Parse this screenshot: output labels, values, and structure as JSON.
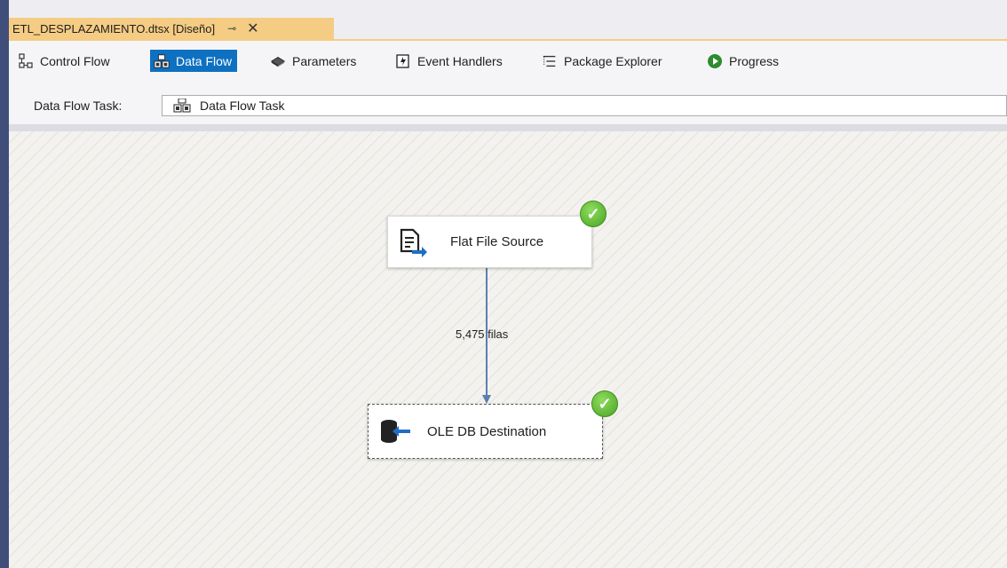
{
  "document_tab": {
    "title": "ETL_DESPLAZAMIENTO.dtsx [Diseño]",
    "pin_icon": "pin-icon",
    "close_icon": "close-icon"
  },
  "designer_tabs": [
    {
      "label": "Control Flow",
      "icon": "control-flow-icon",
      "active": false
    },
    {
      "label": "Data Flow",
      "icon": "data-flow-icon",
      "active": true
    },
    {
      "label": "Parameters",
      "icon": "parameters-icon",
      "active": false
    },
    {
      "label": "Event Handlers",
      "icon": "event-handlers-icon",
      "active": false
    },
    {
      "label": "Package Explorer",
      "icon": "package-explorer-icon",
      "active": false
    },
    {
      "label": "Progress",
      "icon": "progress-icon",
      "active": false
    }
  ],
  "task_selector": {
    "label": "Data Flow Task:",
    "value": "Data Flow Task"
  },
  "components": {
    "source": {
      "label": "Flat File Source",
      "status": "success"
    },
    "destination": {
      "label": "OLE DB Destination",
      "status": "success"
    }
  },
  "path": {
    "rows_label": "5,475 filas"
  },
  "colors": {
    "active_tab": "#0e70c0",
    "document_tab": "#f5cc84",
    "path_arrow": "#5b7fb0",
    "success": "#4aa424"
  }
}
